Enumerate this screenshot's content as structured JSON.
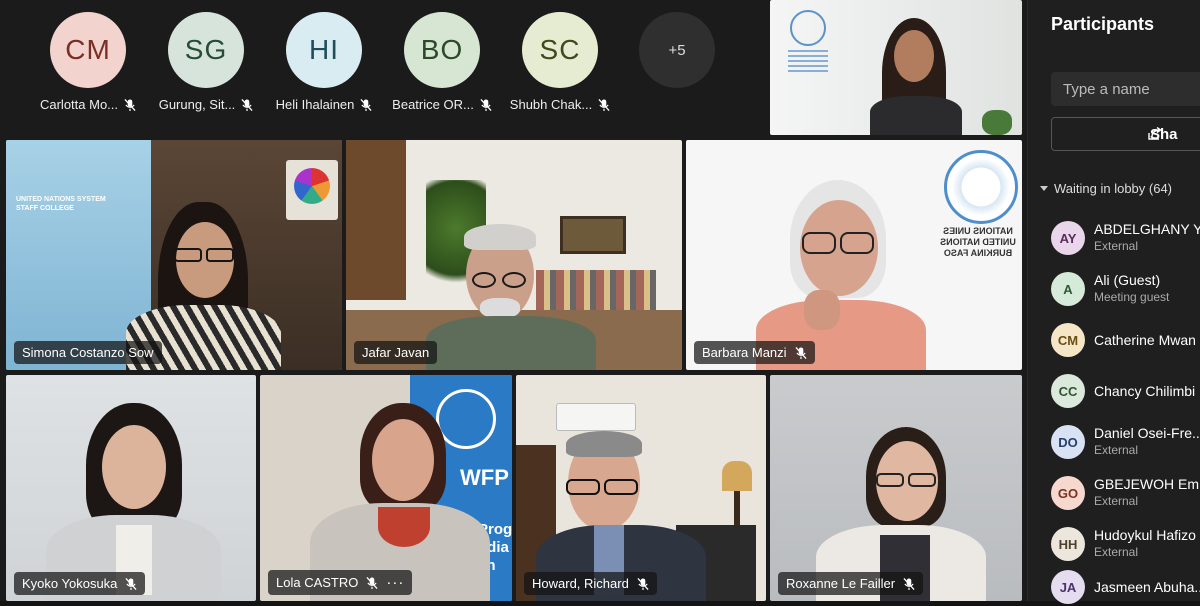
{
  "avatars": [
    {
      "initials": "CM",
      "name": "Carlotta Mo...",
      "bg": "#f3d3cd",
      "fg": "#7a2f26"
    },
    {
      "initials": "SG",
      "name": "Gurung, Sit...",
      "bg": "#d7e4dc",
      "fg": "#264d36"
    },
    {
      "initials": "HI",
      "name": "Heli Ihalainen",
      "bg": "#d8ecf1",
      "fg": "#1f4e5c"
    },
    {
      "initials": "BO",
      "name": "Beatrice OR...",
      "bg": "#d6e6d3",
      "fg": "#2d4a28"
    },
    {
      "initials": "SC",
      "name": "Shubh Chak...",
      "bg": "#e6ecd2",
      "fg": "#3e4a1c"
    }
  ],
  "overflow_label": "+5",
  "tiles": {
    "simona": "Simona Costanzo Sow",
    "jafar": "Jafar Javan",
    "barbara": "Barbara Manzi",
    "kyoko": "Kyoko Yokosuka",
    "lola": "Lola CASTRO",
    "howard": "Howard, Richard",
    "roxanne": "Roxanne Le Failler"
  },
  "backdrop_text": {
    "staff_college": "UNITED NATIONS SYSTEM STAFF COLLEGE",
    "burkina": "NATIONS UNIES UNITED NATIONS BURKINA FASO",
    "wfp": "WFP",
    "wfp_sub": "Program ndia en"
  },
  "panel": {
    "title": "Participants",
    "search_placeholder": "Type a name",
    "share_label": "Sha",
    "lobby_label": "Waiting in lobby (64)",
    "people": [
      {
        "initials": "AY",
        "name": "ABDELGHANY Ya",
        "sub": "External",
        "bg": "#e9d6ea",
        "fg": "#5b2b5e"
      },
      {
        "initials": "A",
        "name": "Ali (Guest)",
        "sub": "Meeting guest",
        "bg": "#d6ead9",
        "fg": "#2a5b33"
      },
      {
        "initials": "CM",
        "name": "Catherine Mwan",
        "sub": "",
        "bg": "#f5e6c8",
        "fg": "#6b4d12"
      },
      {
        "initials": "CC",
        "name": "Chancy Chilimbi",
        "sub": "",
        "bg": "#dbe8dc",
        "fg": "#2f5432"
      },
      {
        "initials": "DO",
        "name": "Daniel Osei-Fre...",
        "sub": "External",
        "bg": "#d9e2f3",
        "fg": "#27406b"
      },
      {
        "initials": "GO",
        "name": "GBEJEWOH Em...",
        "sub": "External",
        "bg": "#f6d8cf",
        "fg": "#7a3321"
      },
      {
        "initials": "HH",
        "name": "Hudoykul Hafizo",
        "sub": "External",
        "bg": "#ece6dc",
        "fg": "#4d4230"
      },
      {
        "initials": "JA",
        "name": "Jasmeen Abuha...",
        "sub": "",
        "bg": "#e5dcf0",
        "fg": "#4a336b"
      }
    ]
  }
}
